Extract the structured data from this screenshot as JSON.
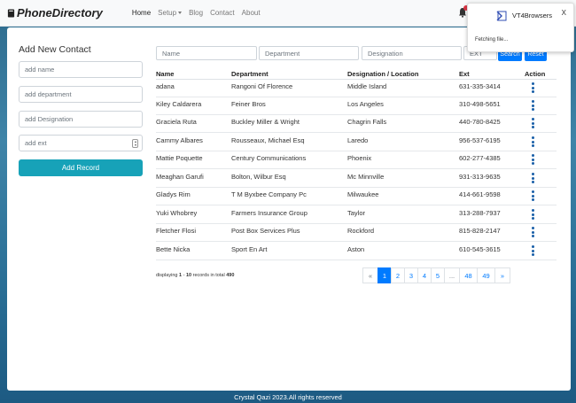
{
  "navbar": {
    "brand": "PhoneDirectory",
    "items": [
      {
        "label": "Home",
        "active": true
      },
      {
        "label": "Setup",
        "dropdown": true
      },
      {
        "label": "Blog"
      },
      {
        "label": "Contact"
      },
      {
        "label": "About"
      }
    ]
  },
  "form": {
    "title": "Add New Contact",
    "name_placeholder": "add name",
    "department_placeholder": "add department",
    "designation_placeholder": "add Designation",
    "ext_placeholder": "add ext",
    "submit_label": "Add Record"
  },
  "filters": {
    "name_placeholder": "Name",
    "department_placeholder": "Department",
    "designation_placeholder": "Designation",
    "ext_placeholder": "EXT",
    "search_label": "Search",
    "reset_label": "Reset"
  },
  "table": {
    "headers": [
      "Name",
      "Department",
      "Designation / Location",
      "Ext",
      "Action"
    ],
    "rows": [
      {
        "name": "adana",
        "department": "Rangoni Of Florence",
        "designation": "Middle Island",
        "ext": "631-335-3414"
      },
      {
        "name": "Kiley Caldarera",
        "department": "Feiner Bros",
        "designation": "Los Angeles",
        "ext": "310-498-5651"
      },
      {
        "name": "Graciela Ruta",
        "department": "Buckley Miller & Wright",
        "designation": "Chagrin Falls",
        "ext": "440-780-8425"
      },
      {
        "name": "Cammy Albares",
        "department": "Rousseaux, Michael Esq",
        "designation": "Laredo",
        "ext": "956-537-6195"
      },
      {
        "name": "Mattie Poquette",
        "department": "Century Communications",
        "designation": "Phoenix",
        "ext": "602-277-4385"
      },
      {
        "name": "Meaghan Garufi",
        "department": "Bolton, Wilbur Esq",
        "designation": "Mc Minnville",
        "ext": "931-313-9635"
      },
      {
        "name": "Gladys Rim",
        "department": "T M Byxbee Company Pc",
        "designation": "Milwaukee",
        "ext": "414-661-9598"
      },
      {
        "name": "Yuki Whobrey",
        "department": "Farmers Insurance Group",
        "designation": "Taylor",
        "ext": "313-288-7937"
      },
      {
        "name": "Fletcher Flosi",
        "department": "Post Box Services Plus",
        "designation": "Rockford",
        "ext": "815-828-2147"
      },
      {
        "name": "Bette Nicka",
        "department": "Sport En Art",
        "designation": "Aston",
        "ext": "610-545-3615"
      }
    ]
  },
  "records": {
    "prefix": "displaying ",
    "from": "1",
    "sep": " - ",
    "to": "10",
    "mid": " records in total ",
    "total": "490"
  },
  "pagination": [
    "«",
    "1",
    "2",
    "3",
    "4",
    "5",
    "...",
    "48",
    "49",
    "»"
  ],
  "pagination_active": "1",
  "footer": "Crystal Qazi 2023.All rights reserved",
  "popup": {
    "title": "VT4Browsers",
    "close": "X",
    "status": "Fetching file..."
  },
  "colors": {
    "primary": "#007bff",
    "info": "#17a2b8",
    "badge": "#dc3545"
  }
}
